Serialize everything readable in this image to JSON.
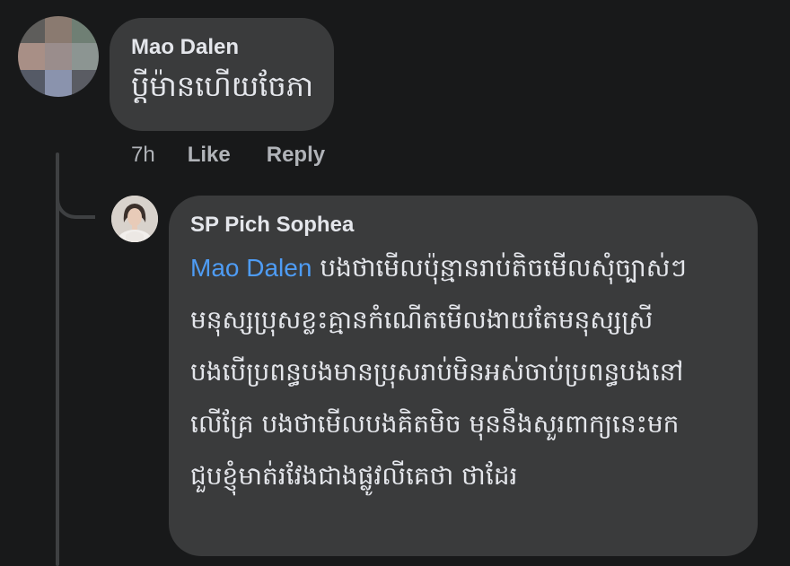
{
  "comment": {
    "author": "Mao Dalen",
    "text": "ប្តីម៉ានហើយចែភា",
    "time": "7h",
    "like_label": "Like",
    "reply_label": "Reply"
  },
  "reply": {
    "author": "SP Pich Sophea",
    "mention": "Mao Dalen",
    "lines": [
      "បងថាមើលប៉ុន្មានរាប់តិចមើលសុំច្បាស់ៗ",
      "មនុស្សប្រុសខ្លះគ្មានកំណើតមើលងាយតែមនុស្សស្រី",
      "បងបើប្រពន្ធបងមានប្រុសរាប់មិនអស់ចាប់ប្រពន្ធបងនៅ",
      "លើគ្រែ បងថាមើលបងគិតមិច មុននឹងសួរពាក្យនេះមក",
      "ជួបខ្ញុំមាត់រវែងជាងផ្លូវលីគេថា ថាដែរ"
    ]
  },
  "colors": {
    "background": "#18191a",
    "bubble": "#3a3b3c",
    "text": "#e4e6eb",
    "secondary_text": "#b0b3b8",
    "mention": "#4e9cf5"
  }
}
